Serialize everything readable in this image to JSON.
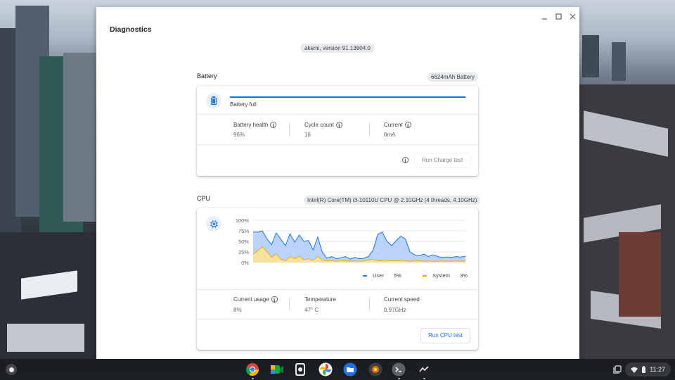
{
  "window": {
    "title": "Diagnostics",
    "version": "akemi, version 91.13904.0",
    "controls": [
      "minimize",
      "maximize",
      "close"
    ]
  },
  "battery": {
    "section_title": "Battery",
    "chip": "6624mAh Battery",
    "icon": "battery-icon",
    "status": "Battery full",
    "level_percent": 100,
    "stats": [
      {
        "label": "Battery health",
        "value": "96%"
      },
      {
        "label": "Cycle count",
        "value": "16"
      },
      {
        "label": "Current",
        "value": "0mA"
      }
    ],
    "button": "Run Charge test"
  },
  "cpu": {
    "section_title": "CPU",
    "chip": "Intel(R) Core(TM) i3-10110U CPU @ 2.10GHz (4 threads, 4.10GHz)",
    "icon": "cpu-icon",
    "legend": [
      {
        "name": "User",
        "value": "5%",
        "color": "#1a73e8"
      },
      {
        "name": "System",
        "value": "3%",
        "color": "#f9ab00"
      }
    ],
    "stats": [
      {
        "label": "Current usage",
        "value": "8%"
      },
      {
        "label": "Temperature",
        "value": "47° C"
      },
      {
        "label": "Current speed",
        "value": "0.97GHz"
      }
    ],
    "button": "Run CPU test"
  },
  "chart_data": {
    "type": "area",
    "ylim": [
      0,
      100
    ],
    "y_ticks": [
      "100%",
      "75%",
      "50%",
      "25%",
      "0%"
    ],
    "grid": true,
    "legend_position": "bottom-right",
    "series": [
      {
        "name": "User",
        "values": [
          72,
          72,
          75,
          56,
          42,
          70,
          55,
          40,
          68,
          48,
          65,
          50,
          52,
          30,
          60,
          24,
          10,
          14,
          9,
          11,
          14,
          8,
          12,
          9,
          10,
          14,
          30,
          67,
          72,
          50,
          40,
          52,
          62,
          55,
          25,
          18,
          16,
          20,
          14,
          18,
          14,
          12,
          13,
          12,
          14,
          13,
          15
        ]
      },
      {
        "name": "System",
        "values": [
          20,
          28,
          37,
          26,
          12,
          20,
          8,
          4,
          14,
          9,
          14,
          7,
          9,
          5,
          14,
          6,
          4,
          5,
          3,
          5,
          4,
          3,
          4,
          3,
          4,
          6,
          8,
          4,
          4,
          5,
          4,
          4,
          5,
          4,
          3,
          4,
          4,
          3,
          4,
          3,
          3,
          4,
          3,
          3,
          4,
          3,
          3
        ]
      }
    ]
  },
  "shelf": {
    "apps": [
      "chrome-icon",
      "meet-icon",
      "camera-icon",
      "photos-icon",
      "files-icon",
      "diagnostics-app-icon",
      "terminal-icon",
      "diagnostics-graph-icon"
    ],
    "time": "11:27"
  }
}
